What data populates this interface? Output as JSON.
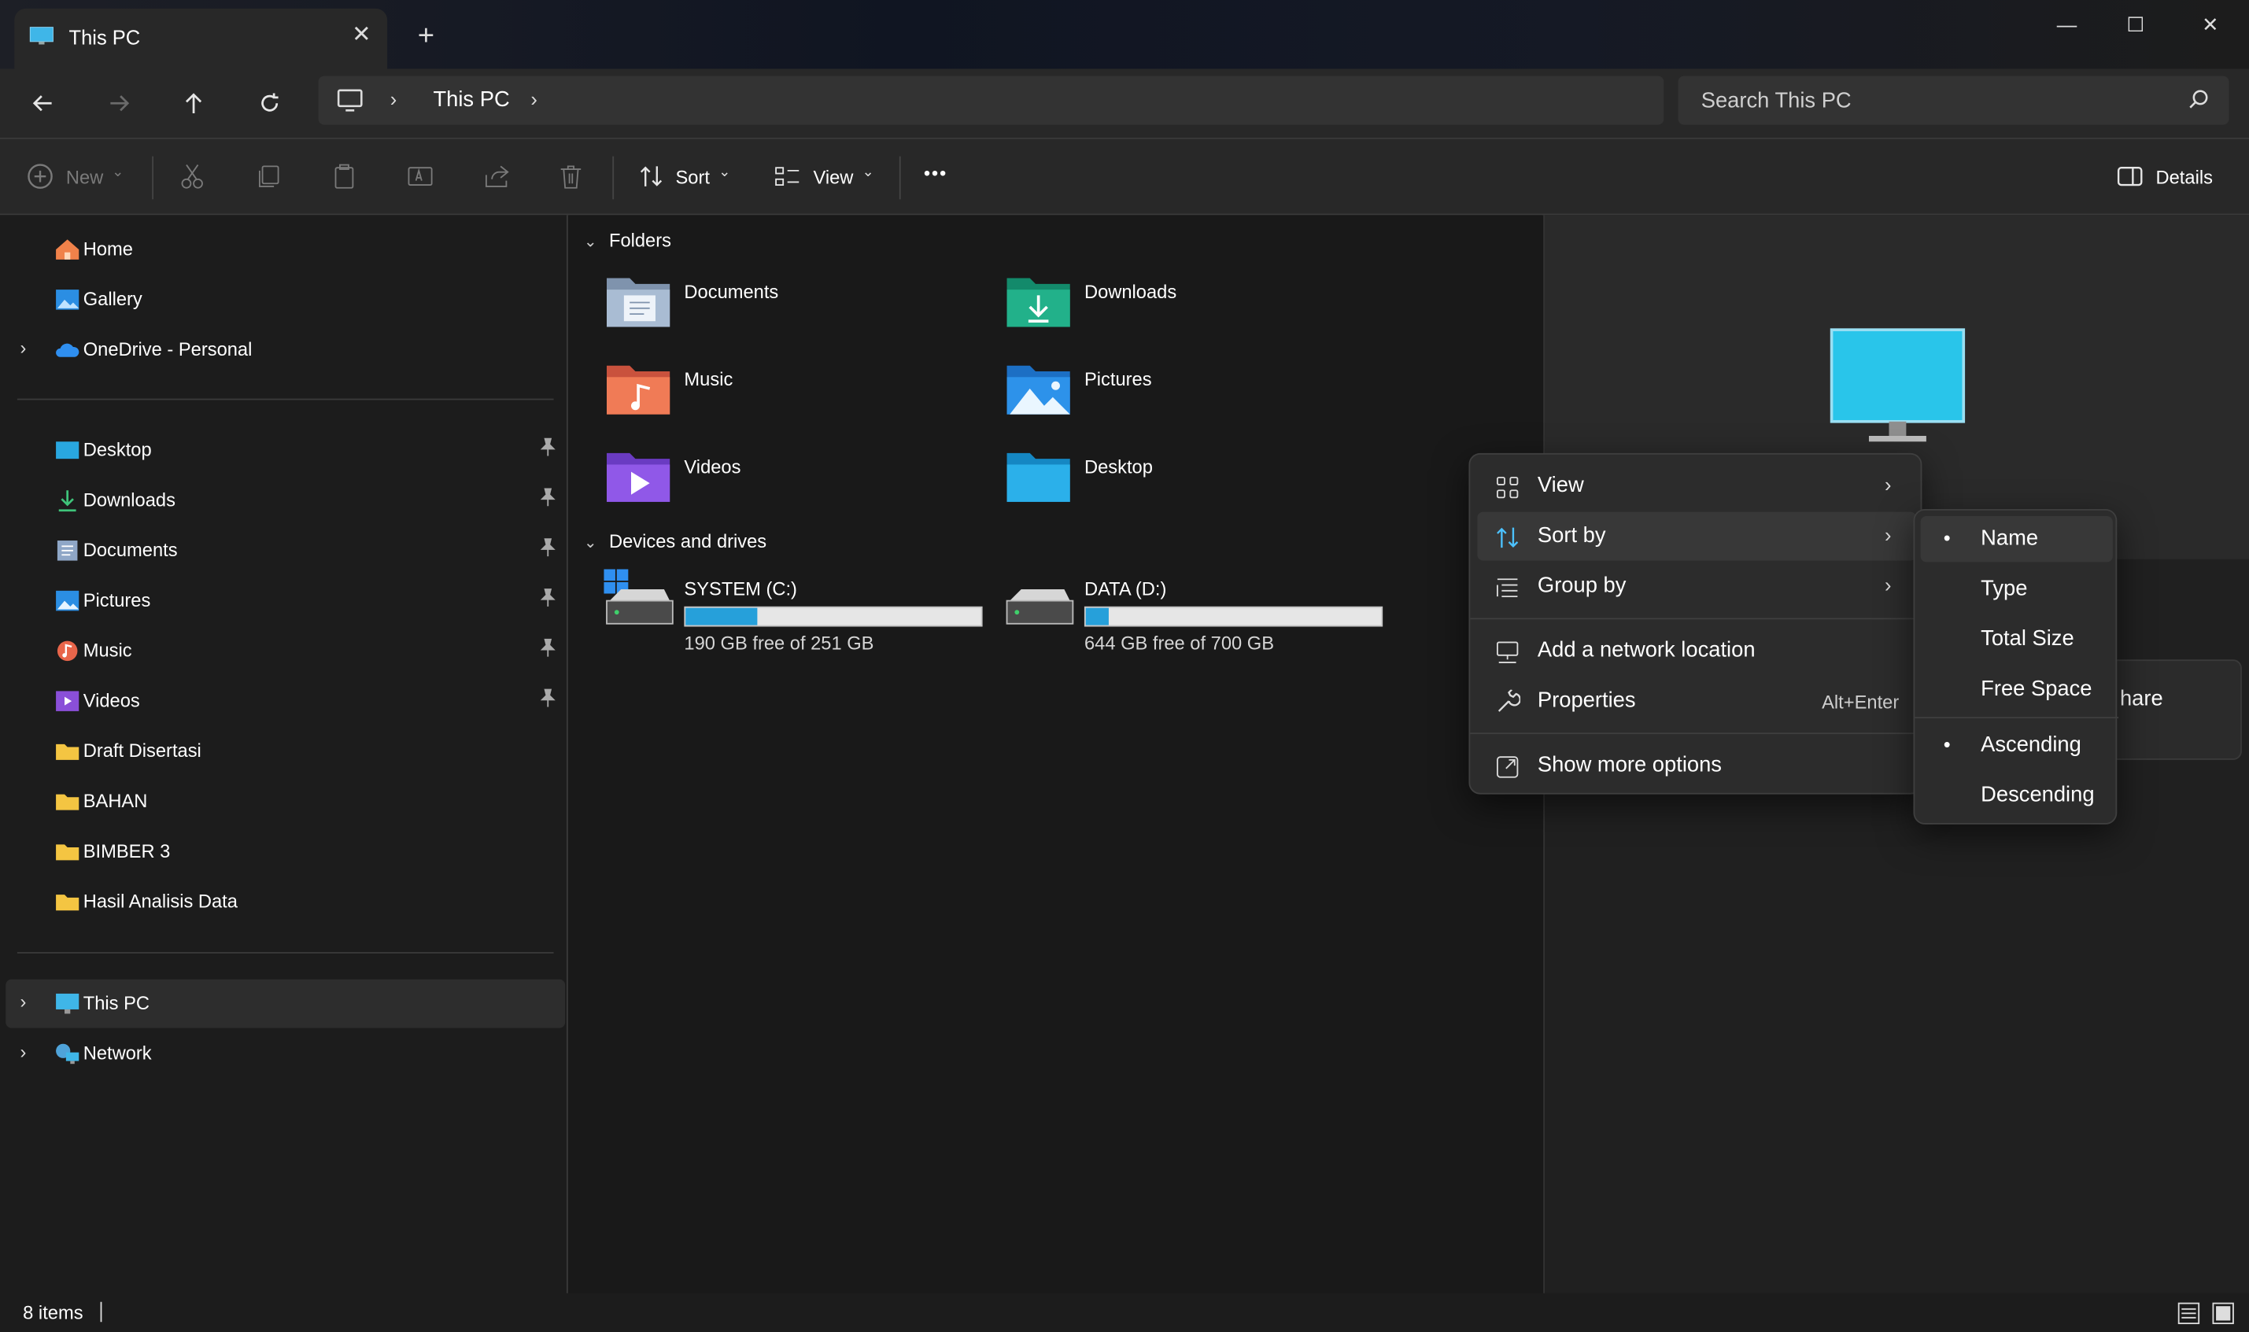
{
  "window": {
    "tab_title": "This PC",
    "new_tab_symbol": "+",
    "close_symbol": "✕",
    "minimize_symbol": "—",
    "maximize_symbol": "☐",
    "close_window_symbol": "✕"
  },
  "address": {
    "crumbs": [
      "This PC"
    ],
    "search_placeholder": "Search This PC"
  },
  "toolbar": {
    "new_label": "New",
    "sort_label": "Sort",
    "view_label": "View",
    "more_label": "•••",
    "details_label": "Details"
  },
  "sidebar": {
    "top": [
      {
        "label": "Home",
        "icon": "home-icon"
      },
      {
        "label": "Gallery",
        "icon": "gallery-icon"
      },
      {
        "label": "OneDrive - Personal",
        "icon": "onedrive-icon",
        "expandable": true
      }
    ],
    "quick": [
      {
        "label": "Desktop",
        "icon": "desktop-folder-icon",
        "pinned": true
      },
      {
        "label": "Downloads",
        "icon": "downloads-icon",
        "pinned": true
      },
      {
        "label": "Documents",
        "icon": "documents-icon",
        "pinned": true
      },
      {
        "label": "Pictures",
        "icon": "pictures-icon",
        "pinned": true
      },
      {
        "label": "Music",
        "icon": "music-icon",
        "pinned": true
      },
      {
        "label": "Videos",
        "icon": "videos-icon",
        "pinned": true
      },
      {
        "label": "Draft Disertasi",
        "icon": "folder-icon",
        "pinned": false
      },
      {
        "label": "BAHAN",
        "icon": "folder-icon",
        "pinned": false
      },
      {
        "label": "BIMBER 3",
        "icon": "folder-icon",
        "pinned": false
      },
      {
        "label": "Hasil Analisis Data",
        "icon": "folder-icon",
        "pinned": false
      }
    ],
    "bottom": [
      {
        "label": "This PC",
        "icon": "this-pc-icon",
        "selected": true
      },
      {
        "label": "Network",
        "icon": "network-icon",
        "selected": false
      }
    ]
  },
  "content": {
    "folders_heading": "Folders",
    "folders": [
      {
        "label": "Documents",
        "icon": "documents-folder-icon"
      },
      {
        "label": "Downloads",
        "icon": "downloads-folder-icon"
      },
      {
        "label": "Music",
        "icon": "music-folder-icon"
      },
      {
        "label": "Pictures",
        "icon": "pictures-folder-icon"
      },
      {
        "label": "Videos",
        "icon": "videos-folder-icon"
      },
      {
        "label": "Desktop",
        "icon": "desktop-folder-icon"
      }
    ],
    "drives_heading": "Devices and drives",
    "drives": [
      {
        "label": "SYSTEM (C:)",
        "free_text": "190 GB free of 251 GB",
        "used_fraction": 0.243
      },
      {
        "label": "DATA (D:)",
        "free_text": "644 GB free of 700 GB",
        "used_fraction": 0.08
      }
    ]
  },
  "details": {
    "share_text": "hare"
  },
  "context_menu": {
    "items": [
      {
        "label": "View",
        "icon": "view-grid-icon",
        "submenu": true
      },
      {
        "label": "Sort by",
        "icon": "sort-icon",
        "submenu": true,
        "active": true
      },
      {
        "label": "Group by",
        "icon": "group-icon",
        "submenu": true
      },
      {
        "label": "Add a network location",
        "icon": "network-location-icon"
      },
      {
        "label": "Properties",
        "icon": "properties-icon",
        "shortcut": "Alt+Enter"
      },
      {
        "label": "Show more options",
        "icon": "more-options-icon"
      }
    ]
  },
  "sort_submenu": {
    "items": [
      {
        "label": "Name",
        "checked": true
      },
      {
        "label": "Type",
        "checked": false
      },
      {
        "label": "Total Size",
        "checked": false
      },
      {
        "label": "Free Space",
        "checked": false
      },
      {
        "label": "Ascending",
        "checked": true
      },
      {
        "label": "Descending",
        "checked": false
      }
    ],
    "dot": "•"
  },
  "status": {
    "items_text": "8 items"
  },
  "colors": {
    "accent": "#26a0da",
    "folder_yellow": "#f4c542"
  }
}
